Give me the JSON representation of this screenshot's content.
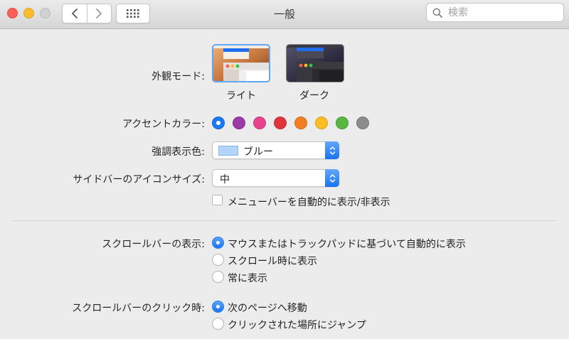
{
  "window": {
    "title": "一般"
  },
  "search": {
    "placeholder": "検索"
  },
  "appearance": {
    "label": "外観モード:",
    "options": [
      {
        "label": "ライト",
        "selected": true
      },
      {
        "label": "ダーク",
        "selected": false
      }
    ]
  },
  "accent": {
    "label": "アクセントカラー:",
    "colors": [
      "#1b79f4",
      "#9a3ba8",
      "#e9428e",
      "#e1353d",
      "#f27f22",
      "#fbbc24",
      "#57b740",
      "#8c8c8c"
    ],
    "selected_index": 0
  },
  "highlight": {
    "label": "強調表示色:",
    "value": "ブルー",
    "swatch_color": "#b3d4fb"
  },
  "sidebar_icon": {
    "label": "サイドバーのアイコンサイズ:",
    "value": "中"
  },
  "menubar": {
    "label": "メニューバーを自動的に表示/非表示",
    "checked": false
  },
  "show_scrollbars": {
    "label": "スクロールバーの表示:",
    "options": [
      {
        "label": "マウスまたはトラックパッドに基づいて自動的に表示",
        "selected": true
      },
      {
        "label": "スクロール時に表示",
        "selected": false
      },
      {
        "label": "常に表示",
        "selected": false
      }
    ]
  },
  "click_scrollbar": {
    "label": "スクロールバーのクリック時:",
    "options": [
      {
        "label": "次のページへ移動",
        "selected": true
      },
      {
        "label": "クリックされた場所にジャンプ",
        "selected": false
      }
    ]
  }
}
